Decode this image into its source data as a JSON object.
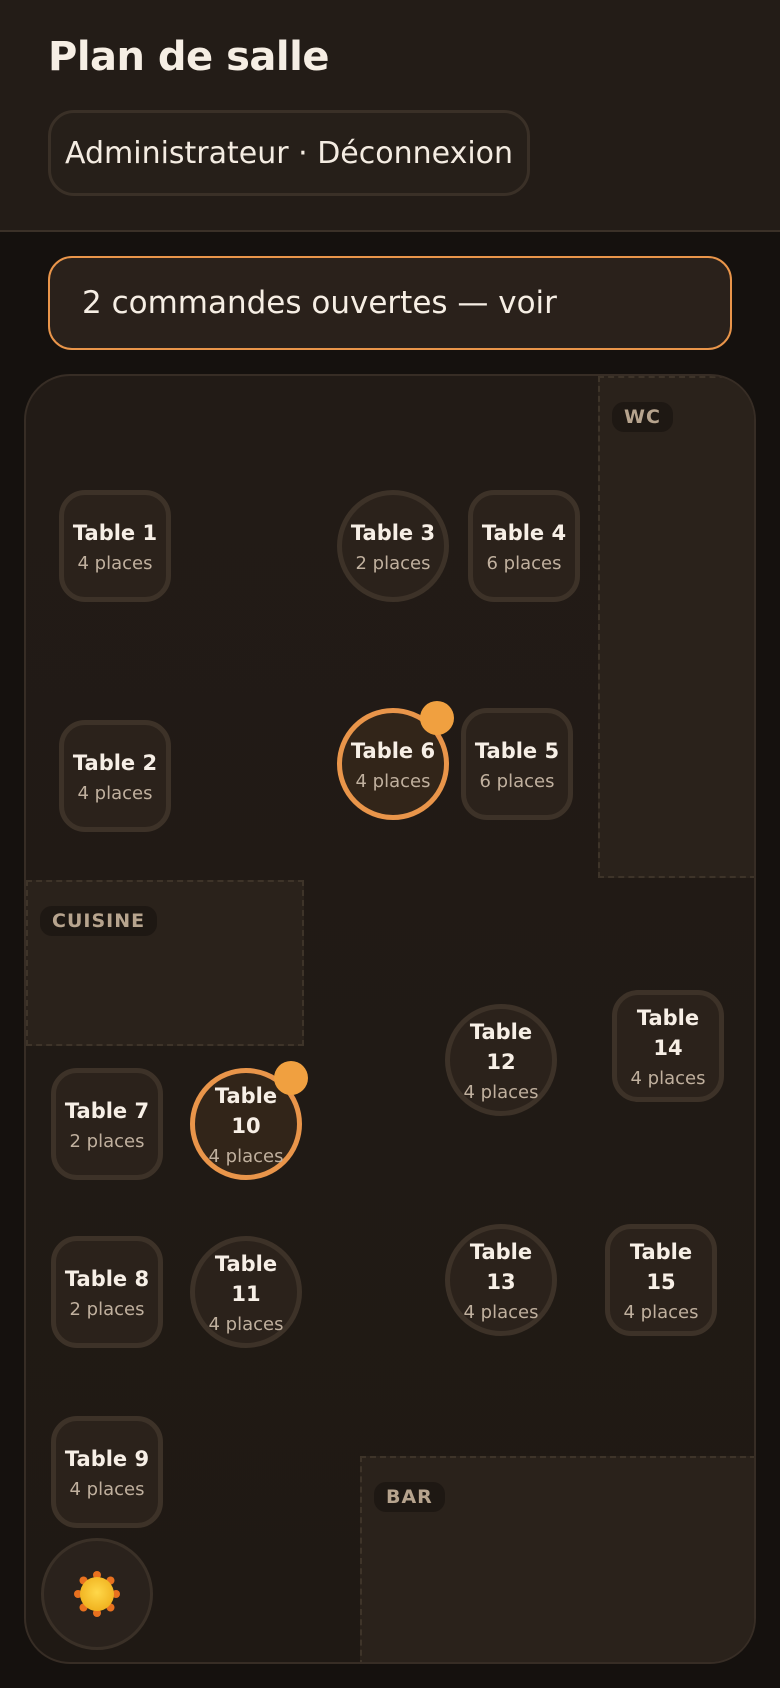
{
  "header": {
    "title": "Plan de salle",
    "user_button": "Administrateur · Déconnexion"
  },
  "banner": {
    "text": "2 commandes ouvertes — voir"
  },
  "zones": {
    "wc": "WC",
    "kitchen": "CUISINE",
    "bar": "BAR"
  },
  "tables": [
    {
      "name": "Table 1",
      "seats": "4 places",
      "shape": "square",
      "occupied": false
    },
    {
      "name": "Table 2",
      "seats": "4 places",
      "shape": "square",
      "occupied": false
    },
    {
      "name": "Table 3",
      "seats": "2 places",
      "shape": "round",
      "occupied": false
    },
    {
      "name": "Table 4",
      "seats": "6 places",
      "shape": "square",
      "occupied": false
    },
    {
      "name": "Table 5",
      "seats": "6 places",
      "shape": "square",
      "occupied": false
    },
    {
      "name": "Table 6",
      "seats": "4 places",
      "shape": "round",
      "occupied": true
    },
    {
      "name": "Table 7",
      "seats": "2 places",
      "shape": "square",
      "occupied": false
    },
    {
      "name": "Table 8",
      "seats": "2 places",
      "shape": "square",
      "occupied": false
    },
    {
      "name": "Table 9",
      "seats": "4 places",
      "shape": "square",
      "occupied": false
    },
    {
      "name": "Table 10",
      "seats": "4 places",
      "shape": "round",
      "occupied": true
    },
    {
      "name": "Table 11",
      "seats": "4 places",
      "shape": "round",
      "occupied": false
    },
    {
      "name": "Table 12",
      "seats": "4 places",
      "shape": "round",
      "occupied": false
    },
    {
      "name": "Table 13",
      "seats": "4 places",
      "shape": "round",
      "occupied": false
    },
    {
      "name": "Table 14",
      "seats": "4 places",
      "shape": "square",
      "occupied": false
    },
    {
      "name": "Table 15",
      "seats": "4 places",
      "shape": "square",
      "occupied": false
    }
  ],
  "colors": {
    "accent": "#e9954a",
    "occupied_dot": "#f0a040",
    "background": "#15110e"
  },
  "icons": {
    "theme_toggle": "sun-icon"
  }
}
